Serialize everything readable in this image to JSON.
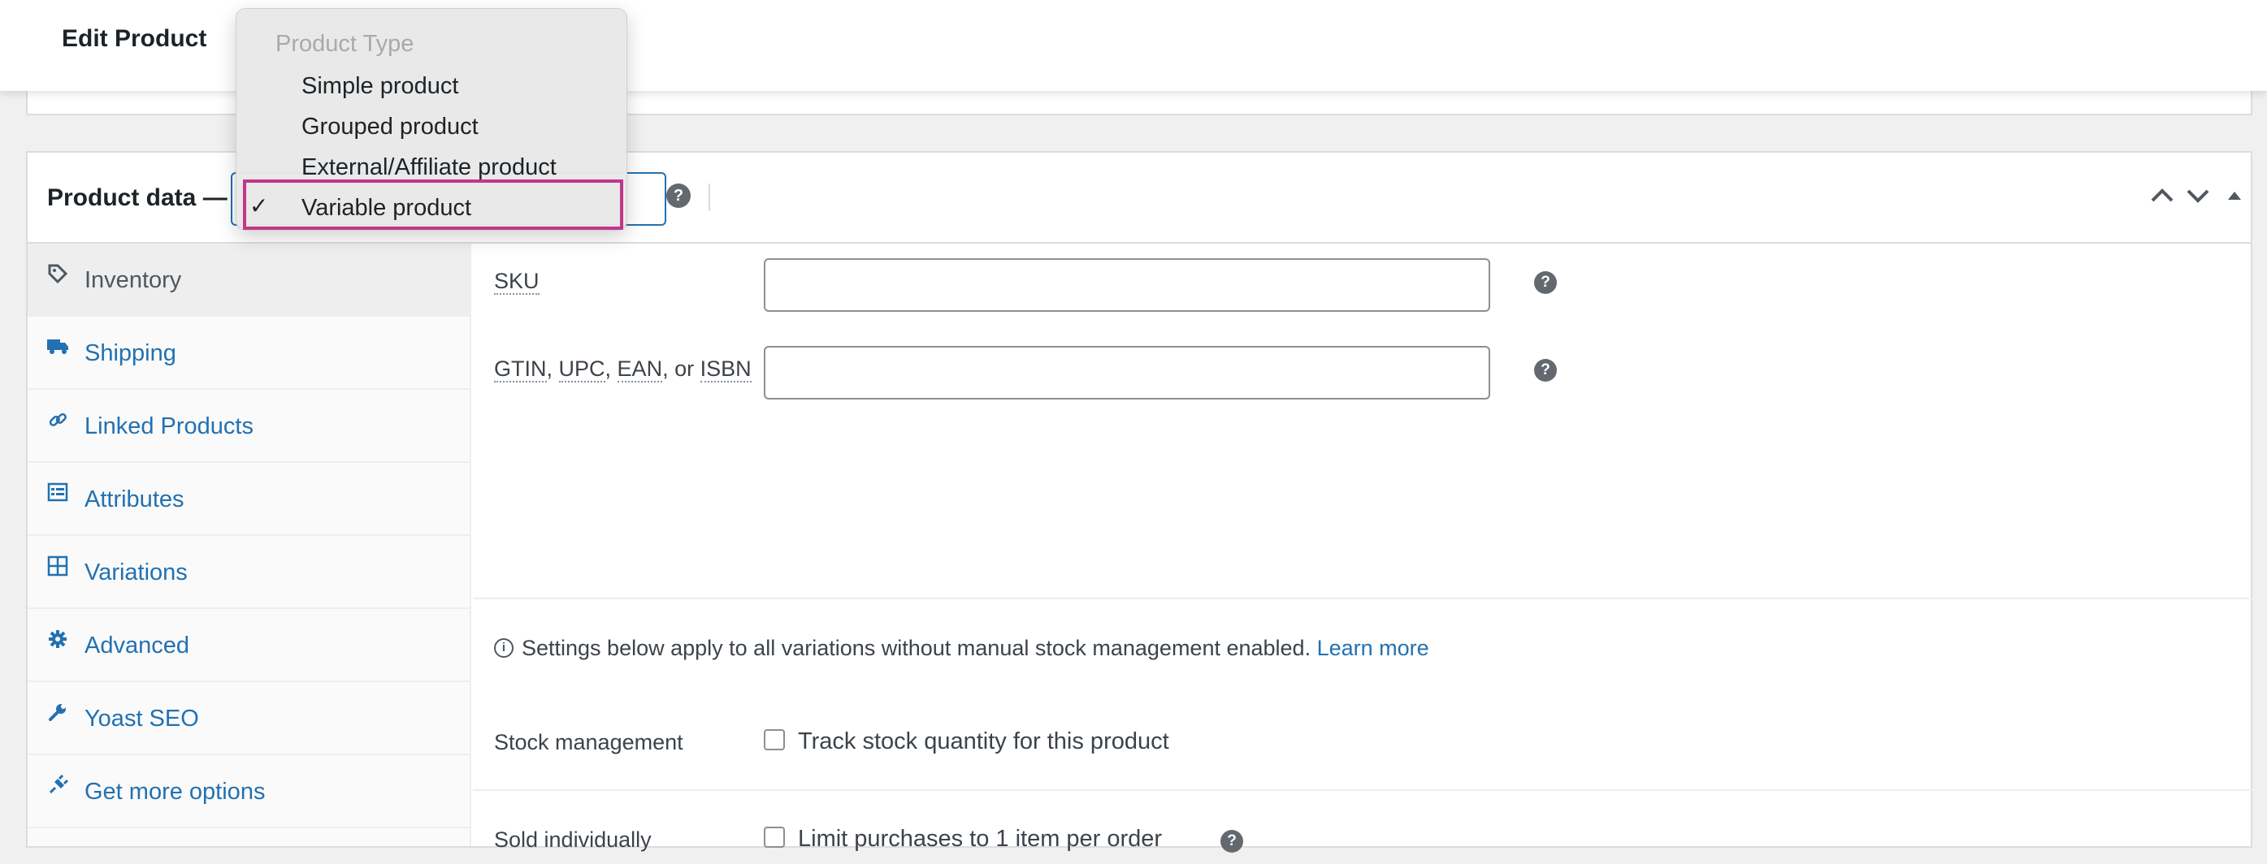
{
  "header": {
    "title": "Edit Product"
  },
  "product_data": {
    "label": "Product data —",
    "help_icon": "help-icon",
    "controls": [
      "chevron-up-icon",
      "chevron-down-icon",
      "toggle-arrow-icon"
    ]
  },
  "dropdown": {
    "group_label": "Product Type",
    "options": [
      {
        "label": "Simple product",
        "selected": false
      },
      {
        "label": "Grouped product",
        "selected": false
      },
      {
        "label": "External/Affiliate product",
        "selected": false
      },
      {
        "label": "Variable product",
        "selected": true
      }
    ],
    "highlight_color": "#c0378a"
  },
  "tabs": [
    {
      "label": "Inventory",
      "icon": "tag-icon",
      "active": true
    },
    {
      "label": "Shipping",
      "icon": "truck-icon",
      "active": false
    },
    {
      "label": "Linked Products",
      "icon": "link-icon",
      "active": false
    },
    {
      "label": "Attributes",
      "icon": "list-icon",
      "active": false
    },
    {
      "label": "Variations",
      "icon": "grid-icon",
      "active": false
    },
    {
      "label": "Advanced",
      "icon": "gear-icon",
      "active": false
    },
    {
      "label": "Yoast SEO",
      "icon": "wrench-icon",
      "active": false
    },
    {
      "label": "Get more options",
      "icon": "plugin-icon",
      "active": false
    }
  ],
  "inventory": {
    "sku_label": "SKU",
    "sku_value": "",
    "gtin_label": {
      "parts": [
        "GTIN",
        "UPC",
        "EAN"
      ],
      "or": "or",
      "last": "ISBN"
    },
    "gtin_value": "",
    "notice_text": "Settings below apply to all variations without manual stock management enabled.",
    "notice_link": "Learn more",
    "stock_label": "Stock management",
    "stock_checkbox_label": "Track stock quantity for this product",
    "sold_label": "Sold individually",
    "sold_checkbox_label": "Limit purchases to 1 item per order"
  },
  "colors": {
    "link": "#2271b1",
    "text": "#3c434a",
    "border": "#dcdcde"
  }
}
